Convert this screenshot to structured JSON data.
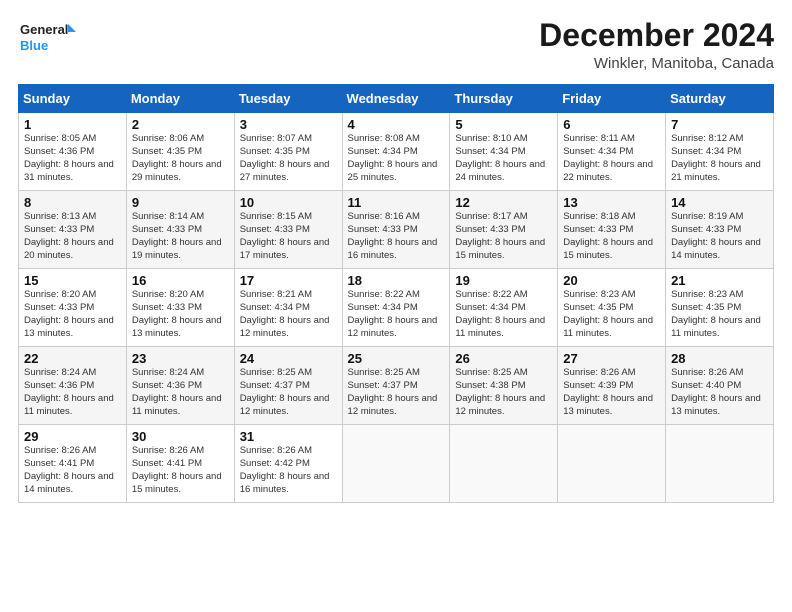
{
  "logo": {
    "line1": "General",
    "line2": "Blue"
  },
  "title": "December 2024",
  "subtitle": "Winkler, Manitoba, Canada",
  "days_header": [
    "Sunday",
    "Monday",
    "Tuesday",
    "Wednesday",
    "Thursday",
    "Friday",
    "Saturday"
  ],
  "weeks": [
    [
      {
        "num": "1",
        "sunrise": "8:05 AM",
        "sunset": "4:36 PM",
        "daylight": "8 hours and 31 minutes."
      },
      {
        "num": "2",
        "sunrise": "8:06 AM",
        "sunset": "4:35 PM",
        "daylight": "8 hours and 29 minutes."
      },
      {
        "num": "3",
        "sunrise": "8:07 AM",
        "sunset": "4:35 PM",
        "daylight": "8 hours and 27 minutes."
      },
      {
        "num": "4",
        "sunrise": "8:08 AM",
        "sunset": "4:34 PM",
        "daylight": "8 hours and 25 minutes."
      },
      {
        "num": "5",
        "sunrise": "8:10 AM",
        "sunset": "4:34 PM",
        "daylight": "8 hours and 24 minutes."
      },
      {
        "num": "6",
        "sunrise": "8:11 AM",
        "sunset": "4:34 PM",
        "daylight": "8 hours and 22 minutes."
      },
      {
        "num": "7",
        "sunrise": "8:12 AM",
        "sunset": "4:34 PM",
        "daylight": "8 hours and 21 minutes."
      }
    ],
    [
      {
        "num": "8",
        "sunrise": "8:13 AM",
        "sunset": "4:33 PM",
        "daylight": "8 hours and 20 minutes."
      },
      {
        "num": "9",
        "sunrise": "8:14 AM",
        "sunset": "4:33 PM",
        "daylight": "8 hours and 19 minutes."
      },
      {
        "num": "10",
        "sunrise": "8:15 AM",
        "sunset": "4:33 PM",
        "daylight": "8 hours and 17 minutes."
      },
      {
        "num": "11",
        "sunrise": "8:16 AM",
        "sunset": "4:33 PM",
        "daylight": "8 hours and 16 minutes."
      },
      {
        "num": "12",
        "sunrise": "8:17 AM",
        "sunset": "4:33 PM",
        "daylight": "8 hours and 15 minutes."
      },
      {
        "num": "13",
        "sunrise": "8:18 AM",
        "sunset": "4:33 PM",
        "daylight": "8 hours and 15 minutes."
      },
      {
        "num": "14",
        "sunrise": "8:19 AM",
        "sunset": "4:33 PM",
        "daylight": "8 hours and 14 minutes."
      }
    ],
    [
      {
        "num": "15",
        "sunrise": "8:20 AM",
        "sunset": "4:33 PM",
        "daylight": "8 hours and 13 minutes."
      },
      {
        "num": "16",
        "sunrise": "8:20 AM",
        "sunset": "4:33 PM",
        "daylight": "8 hours and 13 minutes."
      },
      {
        "num": "17",
        "sunrise": "8:21 AM",
        "sunset": "4:34 PM",
        "daylight": "8 hours and 12 minutes."
      },
      {
        "num": "18",
        "sunrise": "8:22 AM",
        "sunset": "4:34 PM",
        "daylight": "8 hours and 12 minutes."
      },
      {
        "num": "19",
        "sunrise": "8:22 AM",
        "sunset": "4:34 PM",
        "daylight": "8 hours and 11 minutes."
      },
      {
        "num": "20",
        "sunrise": "8:23 AM",
        "sunset": "4:35 PM",
        "daylight": "8 hours and 11 minutes."
      },
      {
        "num": "21",
        "sunrise": "8:23 AM",
        "sunset": "4:35 PM",
        "daylight": "8 hours and 11 minutes."
      }
    ],
    [
      {
        "num": "22",
        "sunrise": "8:24 AM",
        "sunset": "4:36 PM",
        "daylight": "8 hours and 11 minutes."
      },
      {
        "num": "23",
        "sunrise": "8:24 AM",
        "sunset": "4:36 PM",
        "daylight": "8 hours and 11 minutes."
      },
      {
        "num": "24",
        "sunrise": "8:25 AM",
        "sunset": "4:37 PM",
        "daylight": "8 hours and 12 minutes."
      },
      {
        "num": "25",
        "sunrise": "8:25 AM",
        "sunset": "4:37 PM",
        "daylight": "8 hours and 12 minutes."
      },
      {
        "num": "26",
        "sunrise": "8:25 AM",
        "sunset": "4:38 PM",
        "daylight": "8 hours and 12 minutes."
      },
      {
        "num": "27",
        "sunrise": "8:26 AM",
        "sunset": "4:39 PM",
        "daylight": "8 hours and 13 minutes."
      },
      {
        "num": "28",
        "sunrise": "8:26 AM",
        "sunset": "4:40 PM",
        "daylight": "8 hours and 13 minutes."
      }
    ],
    [
      {
        "num": "29",
        "sunrise": "8:26 AM",
        "sunset": "4:41 PM",
        "daylight": "8 hours and 14 minutes."
      },
      {
        "num": "30",
        "sunrise": "8:26 AM",
        "sunset": "4:41 PM",
        "daylight": "8 hours and 15 minutes."
      },
      {
        "num": "31",
        "sunrise": "8:26 AM",
        "sunset": "4:42 PM",
        "daylight": "8 hours and 16 minutes."
      },
      null,
      null,
      null,
      null
    ]
  ]
}
